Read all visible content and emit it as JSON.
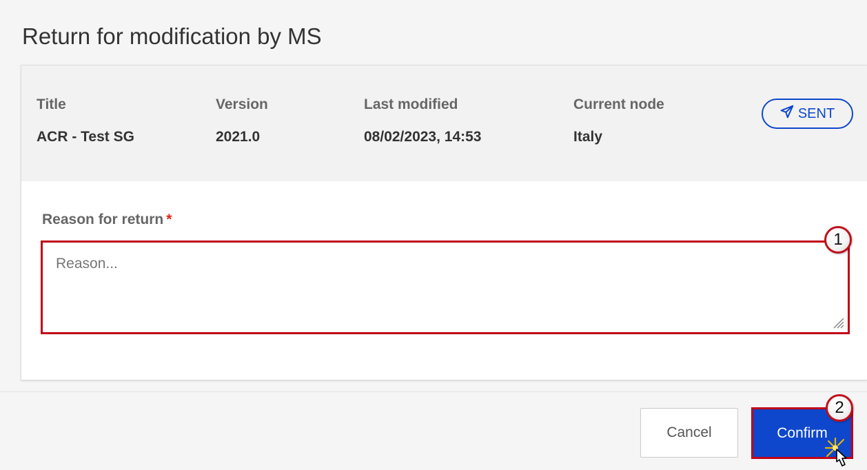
{
  "modal": {
    "title": "Return for modification by MS"
  },
  "meta": {
    "title_label": "Title",
    "title_value": "ACR - Test SG",
    "version_label": "Version",
    "version_value": "2021.0",
    "modified_label": "Last modified",
    "modified_value": "08/02/2023, 14:53",
    "node_label": "Current node",
    "node_value": "Italy",
    "status_icon": "paper-plane-icon",
    "status_label": "SENT"
  },
  "form": {
    "reason_label": "Reason for return",
    "required_marker": "*",
    "reason_placeholder": "Reason..."
  },
  "callouts": {
    "first": "1",
    "second": "2"
  },
  "footer": {
    "cancel_label": "Cancel",
    "confirm_label": "Confirm"
  },
  "colors": {
    "primary": "#0e47cb",
    "highlight": "#c00018",
    "required": "#e2231a"
  }
}
